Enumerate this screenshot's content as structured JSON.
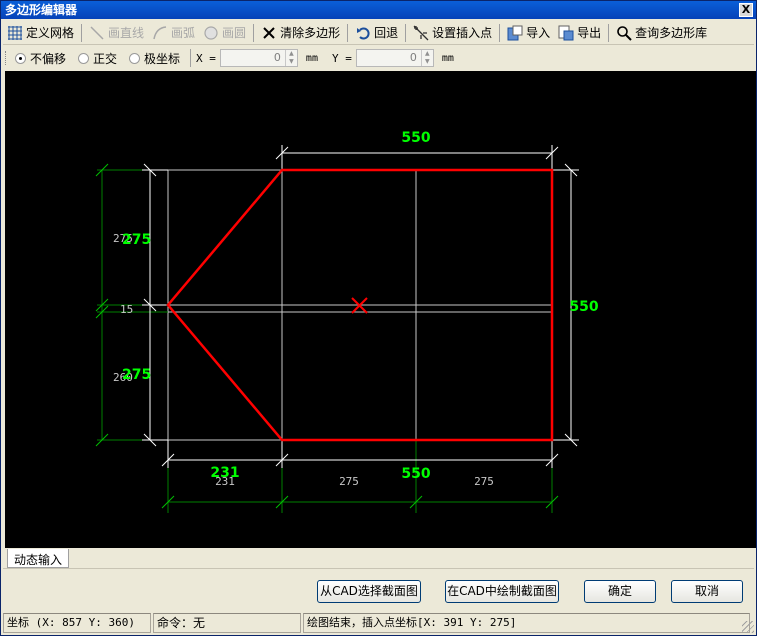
{
  "window": {
    "title": "多边形编辑器",
    "close_label": "X"
  },
  "toolbar": {
    "define_grid": "定义网格",
    "draw_line": "画直线",
    "draw_arc": "画弧",
    "draw_circle": "画圆",
    "clear_polygon": "清除多边形",
    "undo": "回退",
    "set_insert_point": "设置插入点",
    "import": "导入",
    "export": "导出",
    "query_polygon_lib": "查询多边形库"
  },
  "options": {
    "no_offset": "不偏移",
    "orthogonal": "正交",
    "polar": "极坐标",
    "x_label": "X =",
    "x_value": "0",
    "y_label": "Y =",
    "y_value": "0",
    "unit": "mm"
  },
  "drawing": {
    "dim_top": "550",
    "dim_right": "550",
    "dim_bottom_main": "550",
    "dim_bottom_left_green": "231",
    "dim_bottom_seg1": "231",
    "dim_bottom_seg2": "275",
    "dim_bottom_seg3": "275",
    "dim_left_upper_green": "275",
    "dim_left_upper_white": "275",
    "dim_left_mid": "15",
    "dim_left_lower_green": "275",
    "dim_left_lower_white": "260",
    "colors": {
      "polygon": "#ff0000",
      "dim_green": "#00ff00",
      "dim_white": "#ffffff",
      "grid": "#c0c0c0",
      "ext_green": "#008000"
    }
  },
  "tabs": {
    "dynamic_input": "动态输入"
  },
  "buttons": {
    "select_from_cad": "从CAD选择截面图",
    "draw_in_cad": "在CAD中绘制截面图",
    "ok": "确定",
    "cancel": "取消"
  },
  "status": {
    "coords": "坐标 (X: 857 Y: 360)",
    "command": "命令：无",
    "message": "绘图结束，插入点坐标[X: 391 Y: 275]"
  }
}
